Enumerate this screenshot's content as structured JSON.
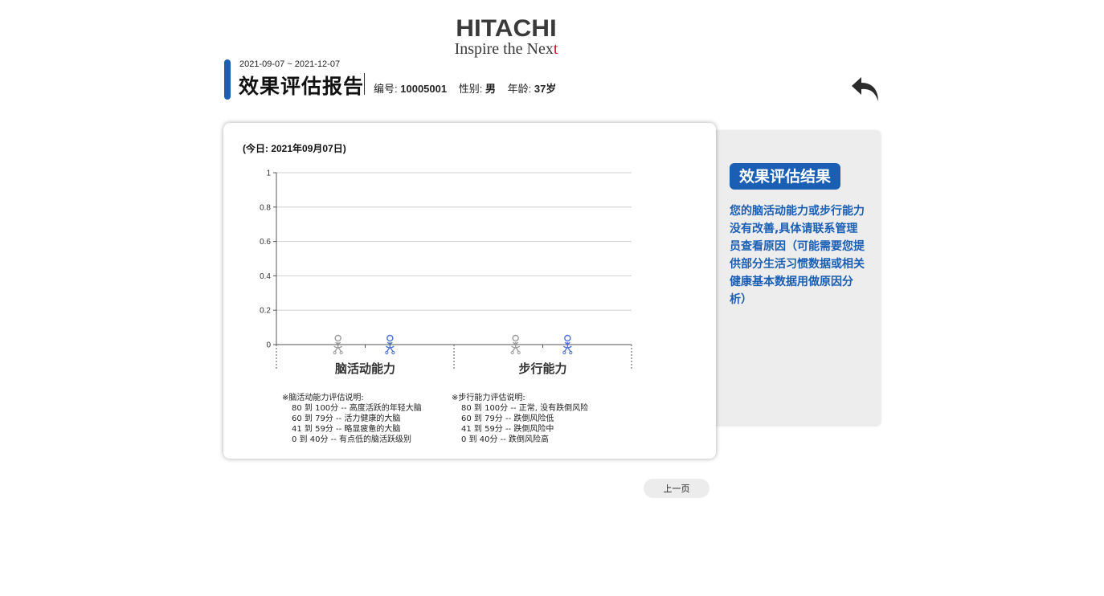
{
  "logo": {
    "brand": "HITACHI",
    "tagline_main": "Inspire the Nex",
    "tagline_last": "t"
  },
  "header": {
    "date_range": "2021-09-07 ~ 2021-12-07",
    "title": "效果评估报告",
    "id_label": "编号:",
    "id_value": "10005001",
    "gender_label": "性别:",
    "gender_value": "男",
    "age_label": "年龄:",
    "age_value": "37岁"
  },
  "back_icon": "undo-arrow-icon",
  "chart_card": {
    "today": "(今日: 2021年09月07日)",
    "brain_notes": {
      "title": "※脑活动能力评估说明:",
      "lines": [
        "80 到 100分 -- 高度活跃的年轻大脑",
        "60 到 79分 -- 活力健康的大脑",
        "41 到 59分 -- 略显疲惫的大脑",
        "0 到 40分 -- 有点低的脑活跃级别"
      ]
    },
    "walk_notes": {
      "title": "※步行能力评估说明:",
      "lines": [
        "80 到 100分 -- 正常, 没有跌倒风险",
        "60 到 79分 -- 跌倒风险低",
        "41 到 59分 -- 跌倒风险中",
        "0 到 40分 -- 跌倒风险高"
      ]
    }
  },
  "chart_data": {
    "type": "scatter",
    "categories": [
      "脑活动能力",
      "步行能力"
    ],
    "y_ticks": [
      "0",
      "0.2",
      "0.4",
      "0.6",
      "0.8",
      "1"
    ],
    "ylim": [
      0,
      1
    ],
    "grid": true,
    "series": [
      {
        "color": "#9a9a9a",
        "values": [
          0,
          0
        ]
      },
      {
        "color": "#4a6fd8",
        "values": [
          0,
          0
        ]
      }
    ]
  },
  "result_panel": {
    "title": "效果评估结果",
    "text": "您的脑活动能力或步行能力没有改善,具体请联系管理员查看原因（可能需要您提供部分生活习惯数据或相关健康基本数据用做原因分析）"
  },
  "footer": {
    "prev_label": "上一页"
  },
  "colors": {
    "accent": "#1a5fb4",
    "panel_bg": "#ededed"
  }
}
